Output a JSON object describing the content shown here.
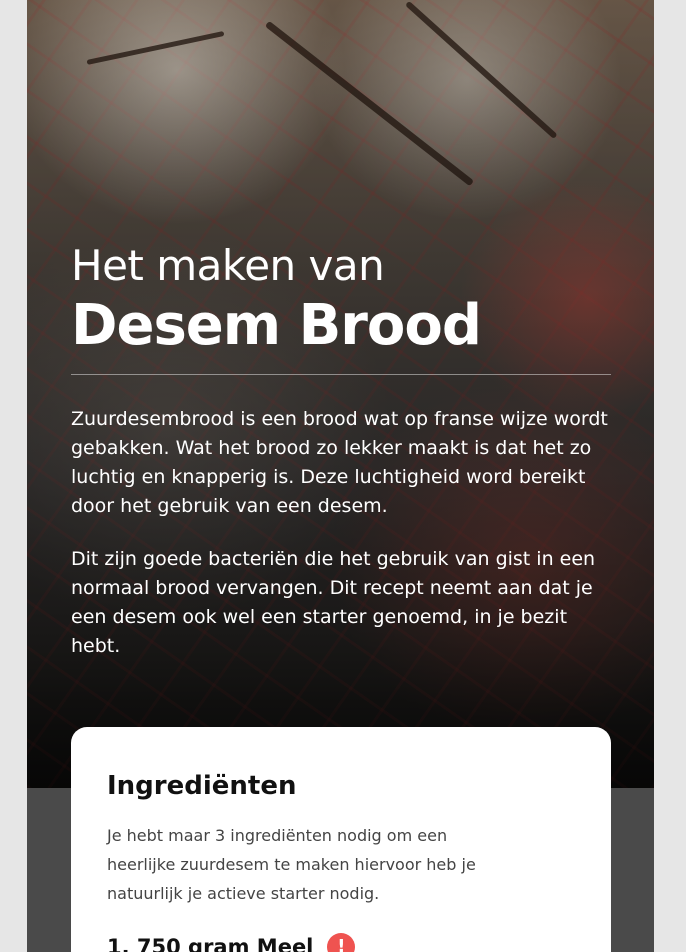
{
  "hero": {
    "title_line1": "Het maken van",
    "title_line2": "Desem Brood",
    "paragraphs": [
      "Zuurdesembrood is een brood wat op franse wijze wordt gebakken. Wat het brood zo lekker maakt is dat het zo luchtig en knapperig is. Deze luchtigheid word bereikt door het gebruik van een desem.",
      "Dit zijn goede bacteriën die het gebruik van gist in een normaal brood vervangen. Dit recept neemt aan dat je een desem ook wel een starter genoemd, in je bezit hebt."
    ]
  },
  "ingredients": {
    "title": "Ingrediënten",
    "description": "Je hebt maar 3 ingrediënten nodig om een heerlijke zuurdesem te maken hiervoor heb je natuurlijk je actieve starter nodig.",
    "items": [
      {
        "label": "1. 750 gram Meel",
        "alert_icon": "!"
      }
    ]
  },
  "colors": {
    "alert": "#ef5350",
    "card_bg": "#ffffff",
    "page_bg": "#e6e6e6"
  }
}
